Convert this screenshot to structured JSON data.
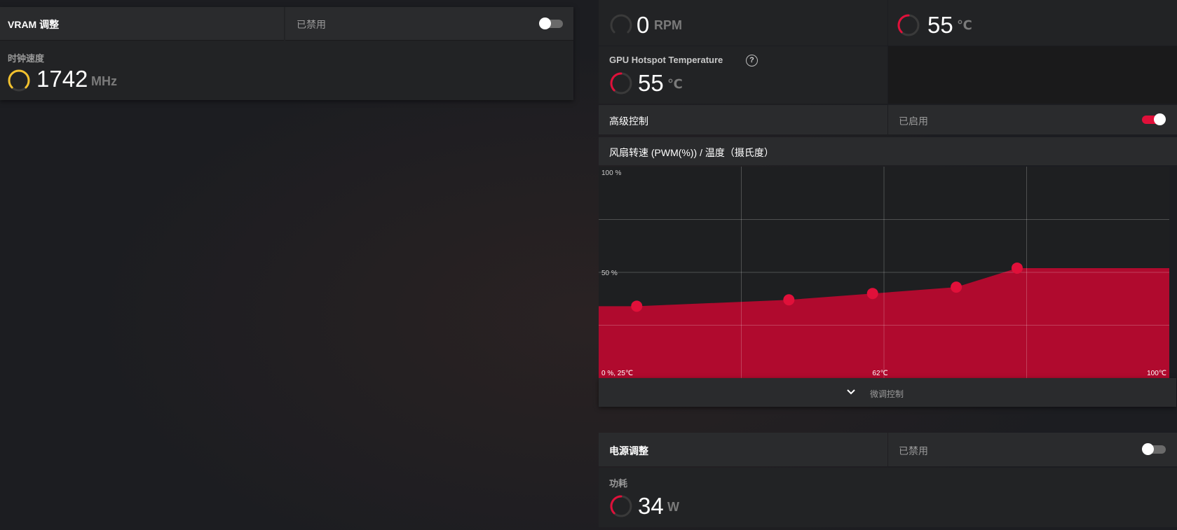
{
  "vram": {
    "title": "VRAM 调整",
    "state": "已禁用",
    "toggle_on": false,
    "clock_label": "时钟速度",
    "clock_value": "1742",
    "clock_unit": "MHz"
  },
  "fan": {
    "rpm_value": "0",
    "rpm_unit": "RPM",
    "temp_value": "55",
    "temp_unit": "℃"
  },
  "hotspot": {
    "label": "GPU Hotspot Temperature",
    "help_glyph": "?",
    "value": "55",
    "unit": "℃"
  },
  "advanced": {
    "label": "高级控制",
    "state": "已启用",
    "toggle_on": true
  },
  "fan_curve": {
    "title": "风扇转速 (PWM(%)) / 温度（摄氏度）",
    "fine_tune_label": "微调控制"
  },
  "power": {
    "title": "电源调整",
    "state": "已禁用",
    "toggle_on": false,
    "consumption_label": "功耗",
    "consumption_value": "34",
    "consumption_unit": "W"
  },
  "colors": {
    "accent": "#e0103a",
    "gauge_yellow": "#f2c12e",
    "fill": "#b00a2e"
  },
  "chart_data": {
    "type": "area",
    "x_unit": "℃",
    "y_unit": "%",
    "xlim": [
      25,
      100
    ],
    "ylim": [
      0,
      100
    ],
    "ytick_labels": [
      "100 %",
      "50 %"
    ],
    "xtick_labels": [
      "0 %, 25℃",
      "62℃",
      "100℃"
    ],
    "points": [
      {
        "x": 30,
        "y": 34
      },
      {
        "x": 50,
        "y": 37
      },
      {
        "x": 61,
        "y": 40
      },
      {
        "x": 72,
        "y": 43
      },
      {
        "x": 80,
        "y": 52
      }
    ],
    "grid": true
  }
}
